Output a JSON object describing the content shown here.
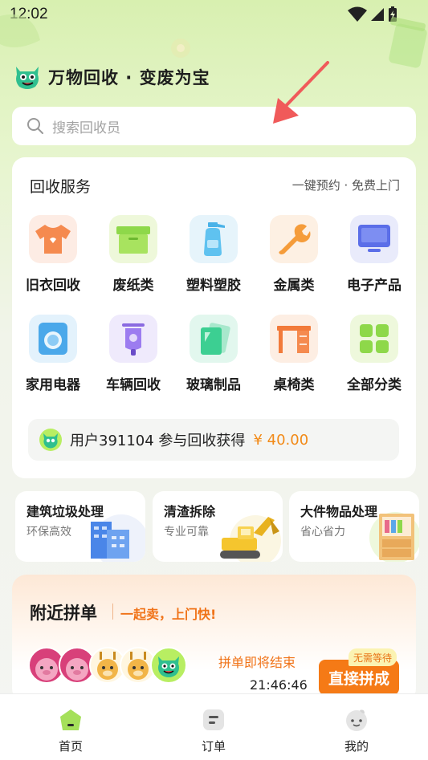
{
  "status_bar": {
    "time": "12:02"
  },
  "header": {
    "title": "万物回收 · 变废为宝"
  },
  "search": {
    "placeholder": "搜索回收员"
  },
  "services": {
    "title": "回收服务",
    "subtitle": "一键预约 · 免费上门",
    "categories": [
      {
        "label": "旧衣回收",
        "icon": "shirt-icon"
      },
      {
        "label": "废纸类",
        "icon": "box-icon"
      },
      {
        "label": "塑料塑胶",
        "icon": "bottle-icon"
      },
      {
        "label": "金属类",
        "icon": "wrench-icon"
      },
      {
        "label": "电子产品",
        "icon": "monitor-icon"
      },
      {
        "label": "家用电器",
        "icon": "washer-icon"
      },
      {
        "label": "车辆回收",
        "icon": "scooter-icon"
      },
      {
        "label": "玻璃制品",
        "icon": "glass-icon"
      },
      {
        "label": "桌椅类",
        "icon": "desk-icon"
      },
      {
        "label": "全部分类",
        "icon": "grid-icon"
      }
    ],
    "ticker": {
      "text": "用户391104 参与回收获得",
      "amount": "¥ 40.00"
    }
  },
  "promos": [
    {
      "title": "建筑垃圾处理",
      "subtitle": "环保高效"
    },
    {
      "title": "清渣拆除",
      "subtitle": "专业可靠"
    },
    {
      "title": "大件物品处理",
      "subtitle": "省心省力"
    }
  ],
  "nearby": {
    "title": "附近拼单",
    "slogan": "一起卖，上门快!",
    "status": "拼单即将结束",
    "timer": "21:46:46",
    "join_label": "直接拼成",
    "badge": "无需等待"
  },
  "nav": [
    {
      "label": "首页",
      "icon": "home-icon",
      "active": true
    },
    {
      "label": "订单",
      "icon": "order-icon",
      "active": false
    },
    {
      "label": "我的",
      "icon": "profile-icon",
      "active": false
    }
  ],
  "colors": {
    "accent": "#f57a16",
    "brand_green": "#9ee04c",
    "background": "#f4f5f3"
  }
}
